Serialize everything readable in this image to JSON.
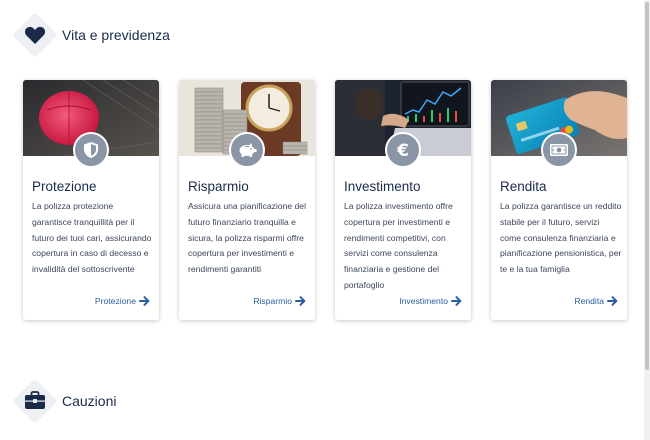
{
  "sections": [
    {
      "title": "Vita e previdenza",
      "icon": "heart-icon"
    },
    {
      "title": "Cauzioni",
      "icon": "briefcase-icon"
    }
  ],
  "cards": [
    {
      "title": "Protezione",
      "description": "La polizza protezione garantisce tranquillità per il futuro dei tuoi cari, assicurando copertura in caso di decesso e invalidità del sottoscrivente",
      "link": "Protezione",
      "icon": "shield-icon",
      "image": "red-umbrella-photo"
    },
    {
      "title": "Risparmio",
      "description": "Assicura una pianificazione del futuro finanziario tranquilla e sicura, la polizza risparmi offre copertura per investimenti e rendimenti garantiti",
      "link": "Risparmio",
      "icon": "piggy-bank-icon",
      "image": "coins-clock-photo"
    },
    {
      "title": "Investimento",
      "description": "La polizza investimento offre copertura per investimenti e rendimenti competitivi, con servizi come consulenza finanziaria e gestione del portafoglio",
      "link": "Investimento",
      "icon": "euro-icon",
      "image": "laptop-chart-photo"
    },
    {
      "title": "Rendita",
      "description": "La polizza garantisce un reddito stabile per il futuro, servizi come consulenza finanziaria e pianificazione pensionistica, per te e la tua famiglia",
      "link": "Rendita",
      "icon": "banknote-icon",
      "image": "credit-card-photo"
    }
  ],
  "colors": {
    "navy": "#1a2b4a",
    "link": "#2a5d9f",
    "badge": "#8a96a6"
  }
}
